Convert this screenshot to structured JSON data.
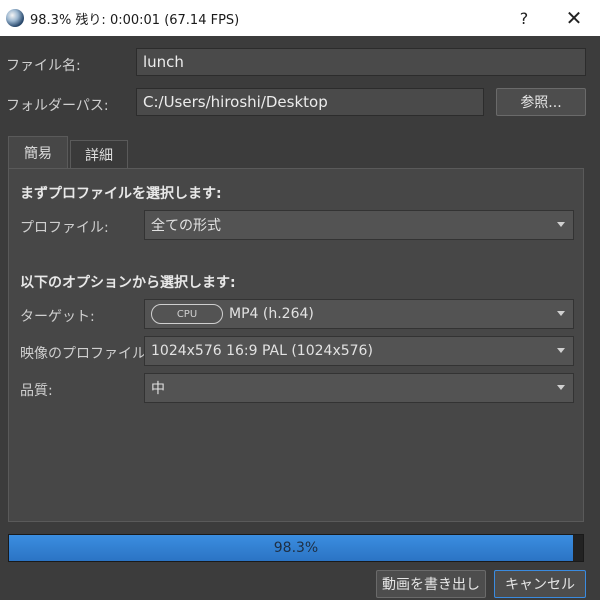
{
  "titlebar": {
    "title": "98.3%  残り: 0:00:01 (67.14 FPS)",
    "help": "?",
    "close": "✕"
  },
  "file": {
    "filename_label": "ファイル名:",
    "filename_value": "lunch",
    "folder_label": "フォルダーパス:",
    "folder_value": "C:/Users/hiroshi/Desktop",
    "browse_button": "参照..."
  },
  "tabs": [
    {
      "label": "簡易",
      "active": true
    },
    {
      "label": "詳細",
      "active": false
    }
  ],
  "simple": {
    "profile_section": "まずプロファイルを選択します:",
    "profile_label": "プロファイル:",
    "profile_value": "全ての形式",
    "options_section": "以下のオプションから選択します:",
    "target_label": "ターゲット:",
    "target_badge": "CPU",
    "target_value": "MP4 (h.264)",
    "video_profile_label": "映像のプロファイル:",
    "video_profile_value": "1024x576 16:9 PAL (1024x576)",
    "quality_label": "品質:",
    "quality_value": "中"
  },
  "progress": {
    "percent": 98.3,
    "text": "98.3%"
  },
  "footer": {
    "export_button": "動画を書き出し",
    "cancel_button": "キャンセル"
  },
  "colors": {
    "progress_fill": "#2b74c4",
    "background": "#3c3c3c"
  }
}
